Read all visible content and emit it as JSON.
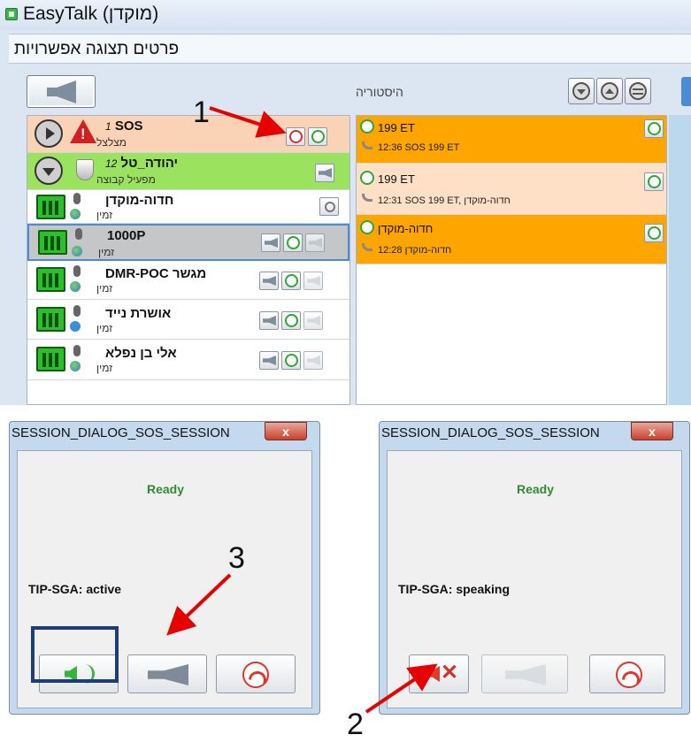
{
  "app": {
    "title": "EasyTalk (מוקדן)",
    "menu": "פרטים תצוגה אפשרויות",
    "history_label": "היסטוריה"
  },
  "users": [
    {
      "num": "1",
      "name": "SOS",
      "status": "מצלצל"
    },
    {
      "num": "12",
      "name": "יהודה_טל",
      "status": "מפעיל קבוצה"
    },
    {
      "name": "חדוה-מוקדן",
      "status": "זמין"
    },
    {
      "name": "1000P",
      "status": "זמין"
    },
    {
      "name": "DMR-POC מגשר",
      "status": "זמין"
    },
    {
      "name": "אושרת נייד",
      "status": "זמין"
    },
    {
      "name": "אלי בן נפלא",
      "status": "זמין"
    }
  ],
  "history": [
    {
      "name": "199 ET",
      "detail": "12:36 SOS 199 ET"
    },
    {
      "name": "199 ET",
      "detail": "12:31 SOS 199 ET, חדוה-מוקדן"
    },
    {
      "name": "חדוה-מוקדן",
      "detail": "12:28 חדוה-מוקדן"
    }
  ],
  "dialog_left": {
    "title": "SESSION_DIALOG_SOS_SESSION",
    "close": "x",
    "ready": "Ready",
    "status": "TIP-SGA: active"
  },
  "dialog_right": {
    "title": "SESSION_DIALOG_SOS_SESSION",
    "close": "x",
    "ready": "Ready",
    "status": "TIP-SGA: speaking"
  },
  "annotations": {
    "a1": "1",
    "a2": "2",
    "a3": "3"
  },
  "colors": {
    "sos_row": "#fad2b5",
    "group_row": "#9be35e",
    "history_orange": "#ffa500",
    "history_peach": "#fde0c6",
    "annotation_arrow": "#e60000",
    "ready_green": "#2f8b2f",
    "highlight_box": "#1d3d7a"
  },
  "icons": [
    "speaker-icon",
    "megaphone-icon",
    "hangup-icon",
    "phone-icon",
    "warning-icon",
    "shield-icon",
    "signal-icon",
    "link-icon"
  ]
}
